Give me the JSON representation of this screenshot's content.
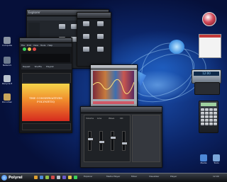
{
  "desktop": {
    "icons": [
      {
        "label": "Computer",
        "color": "#8a94a3"
      },
      {
        "label": "Network",
        "color": "#6d7a8e"
      },
      {
        "label": "Recycle Bin",
        "color": "#b9c2cd"
      },
      {
        "label": "Documents",
        "color": "#c9a55b"
      }
    ],
    "right_icons": [
      {
        "label": "Media",
        "color": "#4d88d8"
      },
      {
        "label": "Tools",
        "color": "#7aa6d9"
      }
    ]
  },
  "explorer": {
    "title": "Explorer",
    "items": [
      "",
      "",
      "",
      "",
      "",
      "",
      "",
      "",
      "",
      "",
      "",
      "",
      "",
      "",
      "",
      "",
      "",
      ""
    ]
  },
  "media": {
    "title": "Media Player",
    "menu": [
      "File",
      "Edit",
      "View",
      "Tools",
      "Help"
    ],
    "controls": [
      "Repeat",
      "Shuffle",
      "Playlist"
    ],
    "poster_text": "THE CONSERVATIVES",
    "poster_sub": "POLYNETIQ"
  },
  "visualizer": {
    "title": "Visualizer"
  },
  "mixer": {
    "title": "Mixer",
    "channels": [
      "Volume",
      "Line",
      "Wave",
      "CD"
    ]
  },
  "clock_gadget": {
    "readout": "12:00"
  },
  "taskbar": {
    "start_label": "Polyrel",
    "tasks": [
      "Explorer",
      "Media Player",
      "Mixer",
      "Visualizer",
      "Player"
    ],
    "clock": "12:00"
  },
  "colors": {
    "accent": "#2f6fe0",
    "poster_top": "#f5d54a",
    "poster_bottom": "#d62b1f"
  }
}
